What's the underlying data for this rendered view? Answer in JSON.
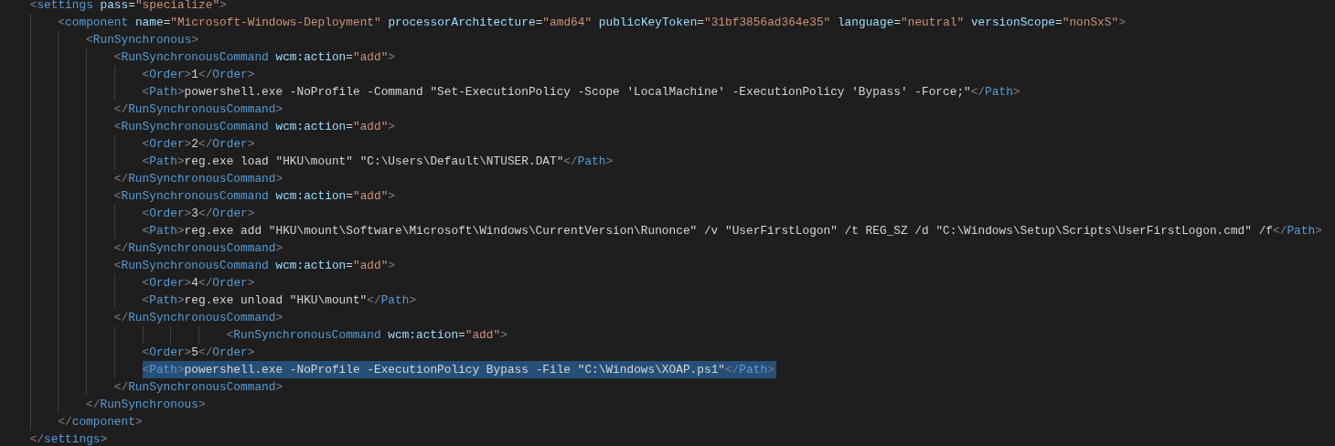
{
  "editor": {
    "lines": [
      {
        "text": "    <settings pass=\"specialize\">",
        "selected": false
      },
      {
        "text": "        <component name=\"Microsoft-Windows-Deployment\" processorArchitecture=\"amd64\" publicKeyToken=\"31bf3856ad364e35\" language=\"neutral\" versionScope=\"nonSxS\">",
        "selected": false
      },
      {
        "text": "            <RunSynchronous>",
        "selected": false
      },
      {
        "text": "                <RunSynchronousCommand wcm:action=\"add\">",
        "selected": false
      },
      {
        "text": "                    <Order>1</Order>",
        "selected": false
      },
      {
        "text": "                    <Path>powershell.exe -NoProfile -Command \"Set-ExecutionPolicy -Scope 'LocalMachine' -ExecutionPolicy 'Bypass' -Force;\"</Path>",
        "selected": false
      },
      {
        "text": "                </RunSynchronousCommand>",
        "selected": false
      },
      {
        "text": "                <RunSynchronousCommand wcm:action=\"add\">",
        "selected": false
      },
      {
        "text": "                    <Order>2</Order>",
        "selected": false
      },
      {
        "text": "                    <Path>reg.exe load \"HKU\\mount\" \"C:\\Users\\Default\\NTUSER.DAT\"</Path>",
        "selected": false
      },
      {
        "text": "                </RunSynchronousCommand>",
        "selected": false
      },
      {
        "text": "                <RunSynchronousCommand wcm:action=\"add\">",
        "selected": false
      },
      {
        "text": "                    <Order>3</Order>",
        "selected": false
      },
      {
        "text": "                    <Path>reg.exe add \"HKU\\mount\\Software\\Microsoft\\Windows\\CurrentVersion\\Runonce\" /v \"UserFirstLogon\" /t REG_SZ /d \"C:\\Windows\\Setup\\Scripts\\UserFirstLogon.cmd\" /f</Path>",
        "selected": false
      },
      {
        "text": "                </RunSynchronousCommand>",
        "selected": false
      },
      {
        "text": "                <RunSynchronousCommand wcm:action=\"add\">",
        "selected": false
      },
      {
        "text": "                    <Order>4</Order>",
        "selected": false
      },
      {
        "text": "                    <Path>reg.exe unload \"HKU\\mount\"</Path>",
        "selected": false
      },
      {
        "text": "                </RunSynchronousCommand>",
        "selected": false
      },
      {
        "text": "                                <RunSynchronousCommand wcm:action=\"add\">",
        "selected": false
      },
      {
        "text": "                    <Order>5</Order>",
        "selected": false
      },
      {
        "text": "                    <Path>powershell.exe -NoProfile -ExecutionPolicy Bypass -File \"C:\\Windows\\XOAP.ps1\"</Path>",
        "selected": true
      },
      {
        "text": "                </RunSynchronousCommand>",
        "selected": false
      },
      {
        "text": "            </RunSynchronous>",
        "selected": false
      },
      {
        "text": "        </component>",
        "selected": false
      },
      {
        "text": "    </settings>",
        "selected": false
      }
    ]
  }
}
